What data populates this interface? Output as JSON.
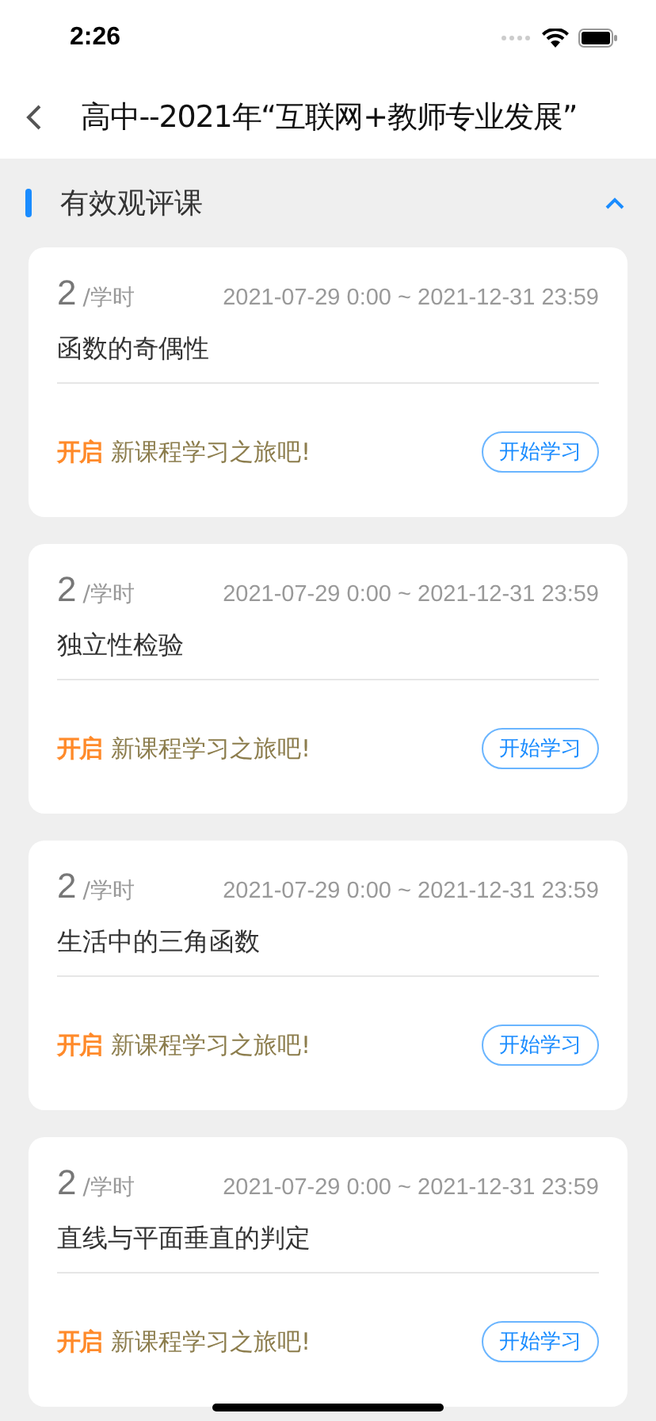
{
  "status_bar": {
    "time": "2:26"
  },
  "nav_bar": {
    "title": "高中--2021年“互联网+教师专业发展”"
  },
  "section": {
    "title": "有效观评课",
    "expanded": true,
    "courses": [
      {
        "hours": "2",
        "unit": "/学时",
        "period": "2021-07-29 0:00 ~ 2021-12-31 23:59",
        "title": "函数的奇偶性",
        "tag": "开启",
        "slogan": "新课程学习之旅吧!",
        "button": "开始学习"
      },
      {
        "hours": "2",
        "unit": "/学时",
        "period": "2021-07-29 0:00 ~ 2021-12-31 23:59",
        "title": "独立性检验",
        "tag": "开启",
        "slogan": "新课程学习之旅吧!",
        "button": "开始学习"
      },
      {
        "hours": "2",
        "unit": "/学时",
        "period": "2021-07-29 0:00 ~ 2021-12-31 23:59",
        "title": "生活中的三角函数",
        "tag": "开启",
        "slogan": "新课程学习之旅吧!",
        "button": "开始学习"
      },
      {
        "hours": "2",
        "unit": "/学时",
        "period": "2021-07-29 0:00 ~ 2021-12-31 23:59",
        "title": "直线与平面垂直的判定",
        "tag": "开启",
        "slogan": "新课程学习之旅吧!",
        "button": "开始学习"
      }
    ]
  }
}
